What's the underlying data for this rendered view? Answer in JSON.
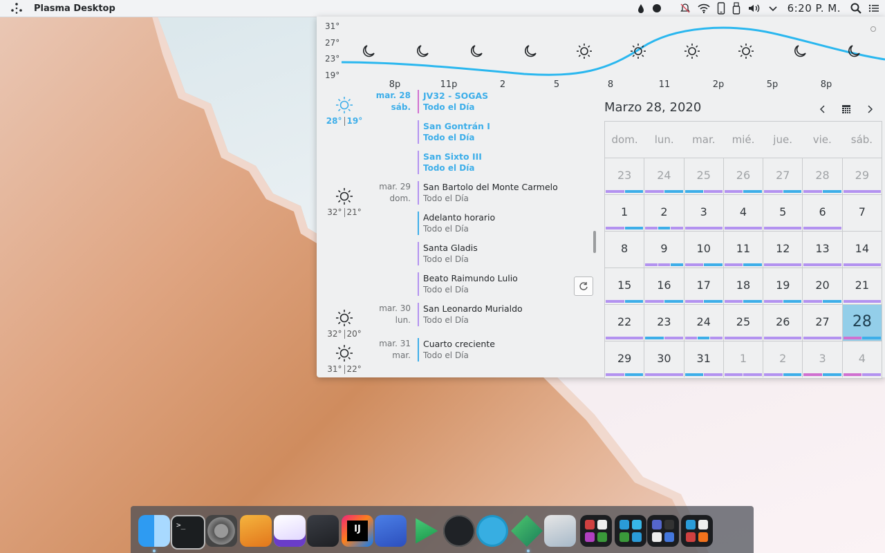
{
  "panel": {
    "title": "Plasma Desktop",
    "clock": "6:20 P. M."
  },
  "weather": {
    "y_ticks": [
      "31°",
      "27°",
      "23°",
      "19°"
    ],
    "hours": [
      {
        "label": "8p",
        "icon": "moon"
      },
      {
        "label": "11p",
        "icon": "moon"
      },
      {
        "label": "2",
        "icon": "moon"
      },
      {
        "label": "5",
        "icon": "moon"
      },
      {
        "label": "8",
        "icon": "sun"
      },
      {
        "label": "11",
        "icon": "sun"
      },
      {
        "label": "2p",
        "icon": "sun"
      },
      {
        "label": "5p",
        "icon": "sun"
      },
      {
        "label": "8p",
        "icon": "moon"
      },
      {
        "label": "",
        "icon": "moon"
      }
    ]
  },
  "agenda": {
    "days": [
      {
        "date": "mar. 28",
        "weekday": "sáb.",
        "high": "28°",
        "low": "19°",
        "today": true,
        "events": [
          {
            "title": "JV32 - SOGAS",
            "sub": "Todo el Día",
            "color": "#d070d0"
          },
          {
            "title": "San Gontrán I",
            "sub": "Todo el Día",
            "color": "#b392f0"
          },
          {
            "title": "San Sixto III",
            "sub": "Todo el Día",
            "color": "#b392f0"
          }
        ]
      },
      {
        "date": "mar. 29",
        "weekday": "dom.",
        "high": "32°",
        "low": "21°",
        "today": false,
        "events": [
          {
            "title": "San Bartolo del Monte Carmelo",
            "sub": "Todo el Día",
            "color": "#b392f0"
          },
          {
            "title": "Adelanto horario",
            "sub": "Todo el Día",
            "color": "#3daee9"
          },
          {
            "title": "Santa Gladis",
            "sub": "Todo el Día",
            "color": "#b392f0"
          },
          {
            "title": "Beato Raimundo Lulio",
            "sub": "Todo el Día",
            "color": "#b392f0"
          }
        ]
      },
      {
        "date": "mar. 30",
        "weekday": "lun.",
        "high": "32°",
        "low": "20°",
        "today": false,
        "events": [
          {
            "title": "San Leonardo Murialdo",
            "sub": "Todo el Día",
            "color": "#b392f0"
          }
        ]
      },
      {
        "date": "mar. 31",
        "weekday": "mar.",
        "high": "31°",
        "low": "22°",
        "today": false,
        "events": [
          {
            "title": "Cuarto creciente",
            "sub": "Todo el Día",
            "color": "#3daee9"
          }
        ]
      }
    ]
  },
  "calendar": {
    "title": "Marzo 28, 2020",
    "weekdays": [
      "dom.",
      "lun.",
      "mar.",
      "mié.",
      "jue.",
      "vie.",
      "sáb."
    ],
    "weeks": [
      [
        {
          "d": "23",
          "m": true
        },
        {
          "d": "24",
          "m": true
        },
        {
          "d": "25",
          "m": true
        },
        {
          "d": "26",
          "m": true
        },
        {
          "d": "27",
          "m": true
        },
        {
          "d": "28",
          "m": true
        },
        {
          "d": "29",
          "m": true
        }
      ],
      [
        {
          "d": "1"
        },
        {
          "d": "2"
        },
        {
          "d": "3"
        },
        {
          "d": "4"
        },
        {
          "d": "5"
        },
        {
          "d": "6"
        },
        {
          "d": "7"
        }
      ],
      [
        {
          "d": "8"
        },
        {
          "d": "9"
        },
        {
          "d": "10"
        },
        {
          "d": "11"
        },
        {
          "d": "12"
        },
        {
          "d": "13"
        },
        {
          "d": "14"
        }
      ],
      [
        {
          "d": "15"
        },
        {
          "d": "16"
        },
        {
          "d": "17"
        },
        {
          "d": "18"
        },
        {
          "d": "19"
        },
        {
          "d": "20"
        },
        {
          "d": "21"
        }
      ],
      [
        {
          "d": "22"
        },
        {
          "d": "23"
        },
        {
          "d": "24"
        },
        {
          "d": "25"
        },
        {
          "d": "26"
        },
        {
          "d": "27"
        },
        {
          "d": "28",
          "sel": true
        }
      ],
      [
        {
          "d": "29"
        },
        {
          "d": "30"
        },
        {
          "d": "31"
        },
        {
          "d": "1",
          "m": true
        },
        {
          "d": "2",
          "m": true
        },
        {
          "d": "3",
          "m": true
        },
        {
          "d": "4",
          "m": true
        }
      ]
    ]
  },
  "colors": {
    "accent": "#3daee9",
    "purple": "#b392f0",
    "magenta": "#d070d0"
  },
  "dock": {
    "apps": [
      "finder-icon",
      "terminal-icon",
      "system-preferences-icon",
      "pages-icon",
      "inkscape-icon",
      "code-editor-icon",
      "intellij-icon",
      "zoom-icon",
      "media-player-icon",
      "deezer-icon",
      "telegram-icon",
      "qt-creator-icon",
      "mail-icon",
      "office-folder-icon",
      "dev-tools-folder-icon",
      "media-folder-icon",
      "browsers-folder-icon"
    ]
  }
}
